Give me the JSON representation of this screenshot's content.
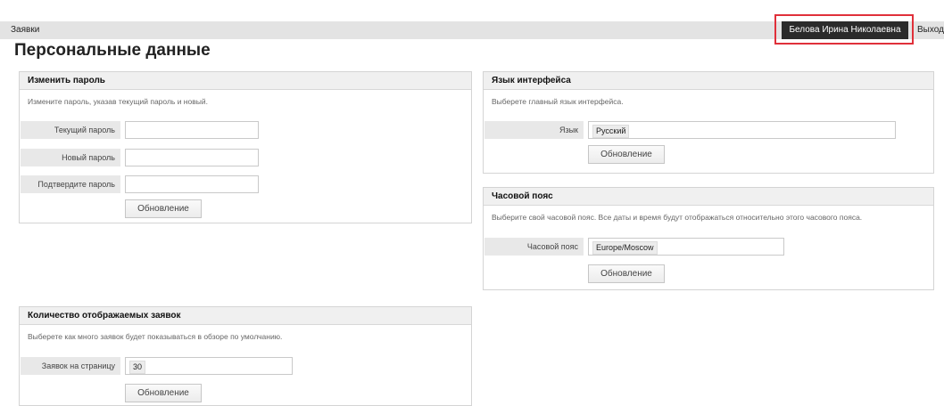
{
  "nav": {
    "link_label": "Заявки",
    "user_name": "Белова Ирина Николаевна",
    "logout_label": "Выход"
  },
  "page": {
    "title": "Персональные данные"
  },
  "password_panel": {
    "title": "Изменить пароль",
    "description": "Измените пароль, указав текущий пароль и новый.",
    "current_label": "Текущий пароль",
    "new_label": "Новый пароль",
    "confirm_label": "Подтвердите пароль",
    "current_value": "",
    "new_value": "",
    "confirm_value": "",
    "button_label": "Обновление"
  },
  "language_panel": {
    "title": "Язык интерфейса",
    "description": "Выберете главный язык интерфейса.",
    "field_label": "Язык",
    "selected": "Русский",
    "button_label": "Обновление"
  },
  "timezone_panel": {
    "title": "Часовой пояс",
    "description": "Выберите свой часовой пояс. Все даты и время будут отображаться относительно этого часового пояса.",
    "field_label": "Часовой пояс",
    "selected": "Europe/Moscow",
    "button_label": "Обновление"
  },
  "tickets_panel": {
    "title": "Количество отображаемых заявок",
    "description": "Выберете как много заявок будет показываться в обзоре по умолчанию.",
    "field_label": "Заявок на страницу",
    "value": "30",
    "button_label": "Обновление"
  },
  "colors": {
    "highlight": "#e0303a",
    "user_button_bg": "#2b2b2b",
    "navbar_bg": "#e3e3e3"
  }
}
